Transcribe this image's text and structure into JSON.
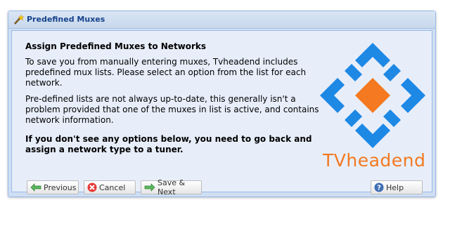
{
  "window": {
    "title": "Predefined Muxes"
  },
  "content": {
    "heading": "Assign Predefined Muxes to Networks",
    "para1": "To save you from manually entering muxes, Tvheadend includes predefined mux lists. Please select an option from the list for each network.",
    "para2": "Pre-defined lists are not always up-to-date, this generally isn't a problem provided that one of the muxes in list is active, and contains network information.",
    "warning": "If you don't see any options below, you need to go back and assign a network type to a tuner."
  },
  "logo": {
    "text": "TVheadend",
    "colors": {
      "blue": "#1e88e5",
      "orange": "#f47920"
    }
  },
  "buttons": {
    "previous": "Previous",
    "cancel": "Cancel",
    "save_next": "Save & Next",
    "help": "Help"
  },
  "icons": {
    "title": "wand-icon",
    "previous": "arrow-left-icon",
    "cancel": "cancel-icon",
    "save_next": "arrow-right-icon",
    "help": "help-icon"
  }
}
